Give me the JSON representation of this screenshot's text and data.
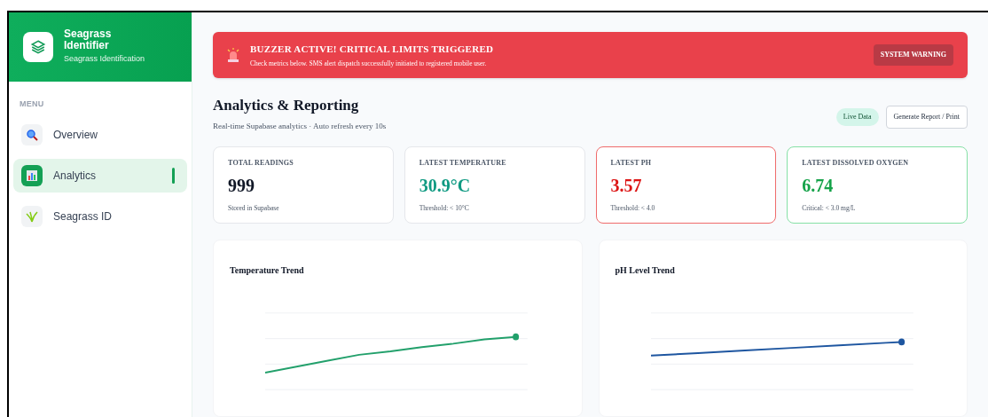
{
  "sidebar": {
    "app_title": "Seagrass Identifier",
    "app_subtitle": "Seagrass Identification",
    "menu_label": "MENU",
    "items": [
      {
        "label": "Overview",
        "kind": "search",
        "selected": false
      },
      {
        "label": "Analytics",
        "kind": "chart",
        "selected": true
      },
      {
        "label": "Seagrass ID",
        "kind": "plant",
        "selected": false
      }
    ]
  },
  "alert": {
    "title": "BUZZER ACTIVE! CRITICAL LIMITS TRIGGERED",
    "message": "Check metrics below. SMS alert dispatch successfully initiated to registered mobile user.",
    "badge": "SYSTEM WARNING"
  },
  "header": {
    "title": "Analytics & Reporting",
    "subtitle": "Real-time Supabase analytics · Auto refresh every 10s",
    "live_badge": "Live Data",
    "report_button": "Generate Report / Print"
  },
  "metrics": [
    {
      "label": "TOTAL READINGS",
      "value": "999",
      "note": "Stored in Supabase",
      "kind": "plain",
      "color": "#111827"
    },
    {
      "label": "LATEST TEMPERATURE",
      "value": "30.9°C",
      "note": "Threshold: < 10°C",
      "kind": "plain",
      "color": "#0f9a82"
    },
    {
      "label": "LATEST PH",
      "value": "3.57",
      "note": "Threshold: < 4.0",
      "kind": "critical",
      "color": "#dc1414"
    },
    {
      "label": "LATEST DISSOLVED OXYGEN",
      "value": "6.74",
      "note": "Critical: < 3.0 mg/L",
      "kind": "good",
      "color": "#16a34a"
    }
  ],
  "charts": [
    {
      "title": "Temperature Trend",
      "color": "#22a06b"
    },
    {
      "title": "pH Level Trend",
      "color": "#1e56a0"
    }
  ]
}
